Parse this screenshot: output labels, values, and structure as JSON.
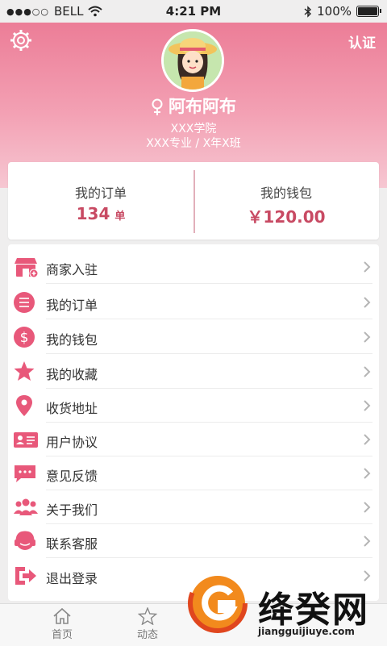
{
  "status_bar": {
    "carrier": "BELL",
    "time": "4:21 PM",
    "battery": "100%"
  },
  "header": {
    "verify_label": "认证",
    "username": "阿布阿布",
    "school": "XXX学院",
    "major_class": "XXX专业 / X年X班",
    "gradient_colors": [
      "#ec7d97",
      "#f6c7d2"
    ]
  },
  "stats": {
    "orders": {
      "label": "我的订单",
      "value": "134",
      "unit": "单"
    },
    "wallet": {
      "label": "我的钱包",
      "value": "￥120.00"
    }
  },
  "menu": {
    "items": [
      {
        "label": "商家入驻",
        "icon": "store-icon"
      },
      {
        "label": "我的订单",
        "icon": "list-icon"
      },
      {
        "label": "我的钱包",
        "icon": "dollar-icon"
      },
      {
        "label": "我的收藏",
        "icon": "star-icon"
      },
      {
        "label": "收货地址",
        "icon": "location-pin-icon"
      },
      {
        "label": "用户协议",
        "icon": "id-card-icon"
      },
      {
        "label": "意见反馈",
        "icon": "chat-bubble-icon"
      },
      {
        "label": "关于我们",
        "icon": "group-icon"
      },
      {
        "label": "联系客服",
        "icon": "headset-icon"
      },
      {
        "label": "退出登录",
        "icon": "logout-icon"
      }
    ]
  },
  "tabbar": {
    "tabs": [
      {
        "label": "首页",
        "icon": "home-icon"
      },
      {
        "label": "动态",
        "icon": "star-outline-icon"
      }
    ]
  },
  "watermark": {
    "name": "绛癸网",
    "url": "jiangguijiuye.com"
  },
  "accent_color": "#e8587a"
}
